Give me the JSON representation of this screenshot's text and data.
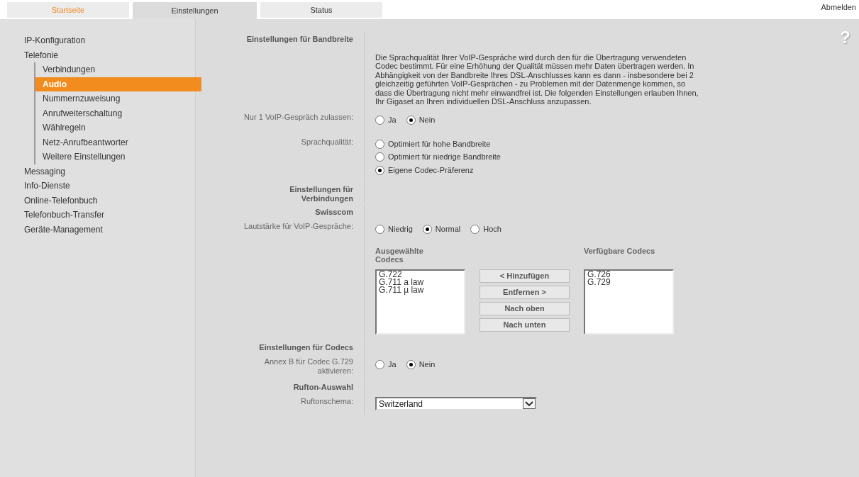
{
  "tabs": [
    {
      "label": "Startseite",
      "selected": false,
      "color": "#f08a24"
    },
    {
      "label": "Einstellungen",
      "selected": true,
      "color": "#333333"
    },
    {
      "label": "Status",
      "selected": false,
      "color": "#333333"
    }
  ],
  "logout": "Abmelden",
  "help": "?",
  "sidebar": {
    "items": [
      {
        "label": "IP-Konfiguration",
        "selected": false
      },
      {
        "label": "Telefonie",
        "selected": false,
        "children": [
          {
            "label": "Verbindungen",
            "selected": false
          },
          {
            "label": "Audio",
            "selected": true
          },
          {
            "label": "Nummernzuweisung",
            "selected": false
          },
          {
            "label": "Anrufweiterschaltung",
            "selected": false
          },
          {
            "label": "Wählregeln",
            "selected": false
          },
          {
            "label": "Netz-Anrufbeantworter",
            "selected": false
          },
          {
            "label": "Weitere Einstellungen",
            "selected": false
          }
        ]
      },
      {
        "label": "Messaging",
        "selected": false
      },
      {
        "label": "Info-Dienste",
        "selected": false
      },
      {
        "label": "Online-Telefonbuch",
        "selected": false
      },
      {
        "label": "Telefonbuch-Transfer",
        "selected": false
      },
      {
        "label": "Geräte-Management",
        "selected": false
      }
    ]
  },
  "rows": [
    {
      "kind": "heading",
      "label": "Einstellungen für Bandbreite"
    },
    {
      "kind": "text",
      "text": "Die Sprachqualität Ihrer VoIP-Gespräche wird durch den für die Übertragung verwendeten Codec bestimmt. Für eine Erhöhung der Qualität müssen mehr Daten übertragen werden. In Abhängigkeit von der Bandbreite Ihres DSL-Anschlusses kann es dann - insbesondere bei 2 gleichzeitig geführten VoIP-Gesprächen - zu Problemen mit der Datenmenge kommen, so dass die Übertragung nicht mehr einwandfrei ist. Die folgenden Einstellungen erlauben Ihnen, Ihr Gigaset an Ihren individuellen DSL-Anschluss anzupassen."
    },
    {
      "kind": "radio",
      "label": "Nur 1 VoIP-Gespräch zulassen:",
      "options": [
        {
          "label": "Ja",
          "selected": false
        },
        {
          "label": "Nein",
          "selected": true
        }
      ]
    },
    {
      "kind": "radio_list",
      "label": "Sprachqualität:",
      "options": [
        {
          "label": "Optimiert für hohe Bandbreite",
          "selected": false
        },
        {
          "label": "Optimiert für niedrige Bandbreite",
          "selected": false
        },
        {
          "label": "Eigene Codec-Präferenz",
          "selected": true
        }
      ]
    },
    {
      "kind": "heading",
      "label": "Einstellungen für Verbindungen"
    },
    {
      "kind": "heading",
      "label": "Swisscom"
    },
    {
      "kind": "radio",
      "label": "Lautstärke für VoIP-Gespräche:",
      "options": [
        {
          "label": "Niedrig",
          "selected": false
        },
        {
          "label": "Normal",
          "selected": true
        },
        {
          "label": "Hoch",
          "selected": false
        }
      ]
    },
    {
      "kind": "codecs",
      "selected_title": "Ausgewählte Codecs",
      "selected_codecs": [
        "G.722",
        "G.711 a law",
        "G.711 µ law"
      ],
      "buttons": [
        "< Hinzufügen",
        "Entfernen >",
        "Nach oben",
        "Nach unten"
      ],
      "available_title": "Verfügbare Codecs",
      "available_codecs": [
        "G.726",
        "G.729"
      ]
    },
    {
      "kind": "heading",
      "label": "Einstellungen für Codecs"
    },
    {
      "kind": "radio",
      "label": "Annex B für Codec G.729 aktivieren:",
      "options": [
        {
          "label": "Ja",
          "selected": false
        },
        {
          "label": "Nein",
          "selected": true
        }
      ]
    },
    {
      "kind": "heading",
      "label": "Rufton-Auswahl"
    },
    {
      "kind": "select",
      "label": "Ruftonschema:",
      "value": "Switzerland"
    }
  ]
}
